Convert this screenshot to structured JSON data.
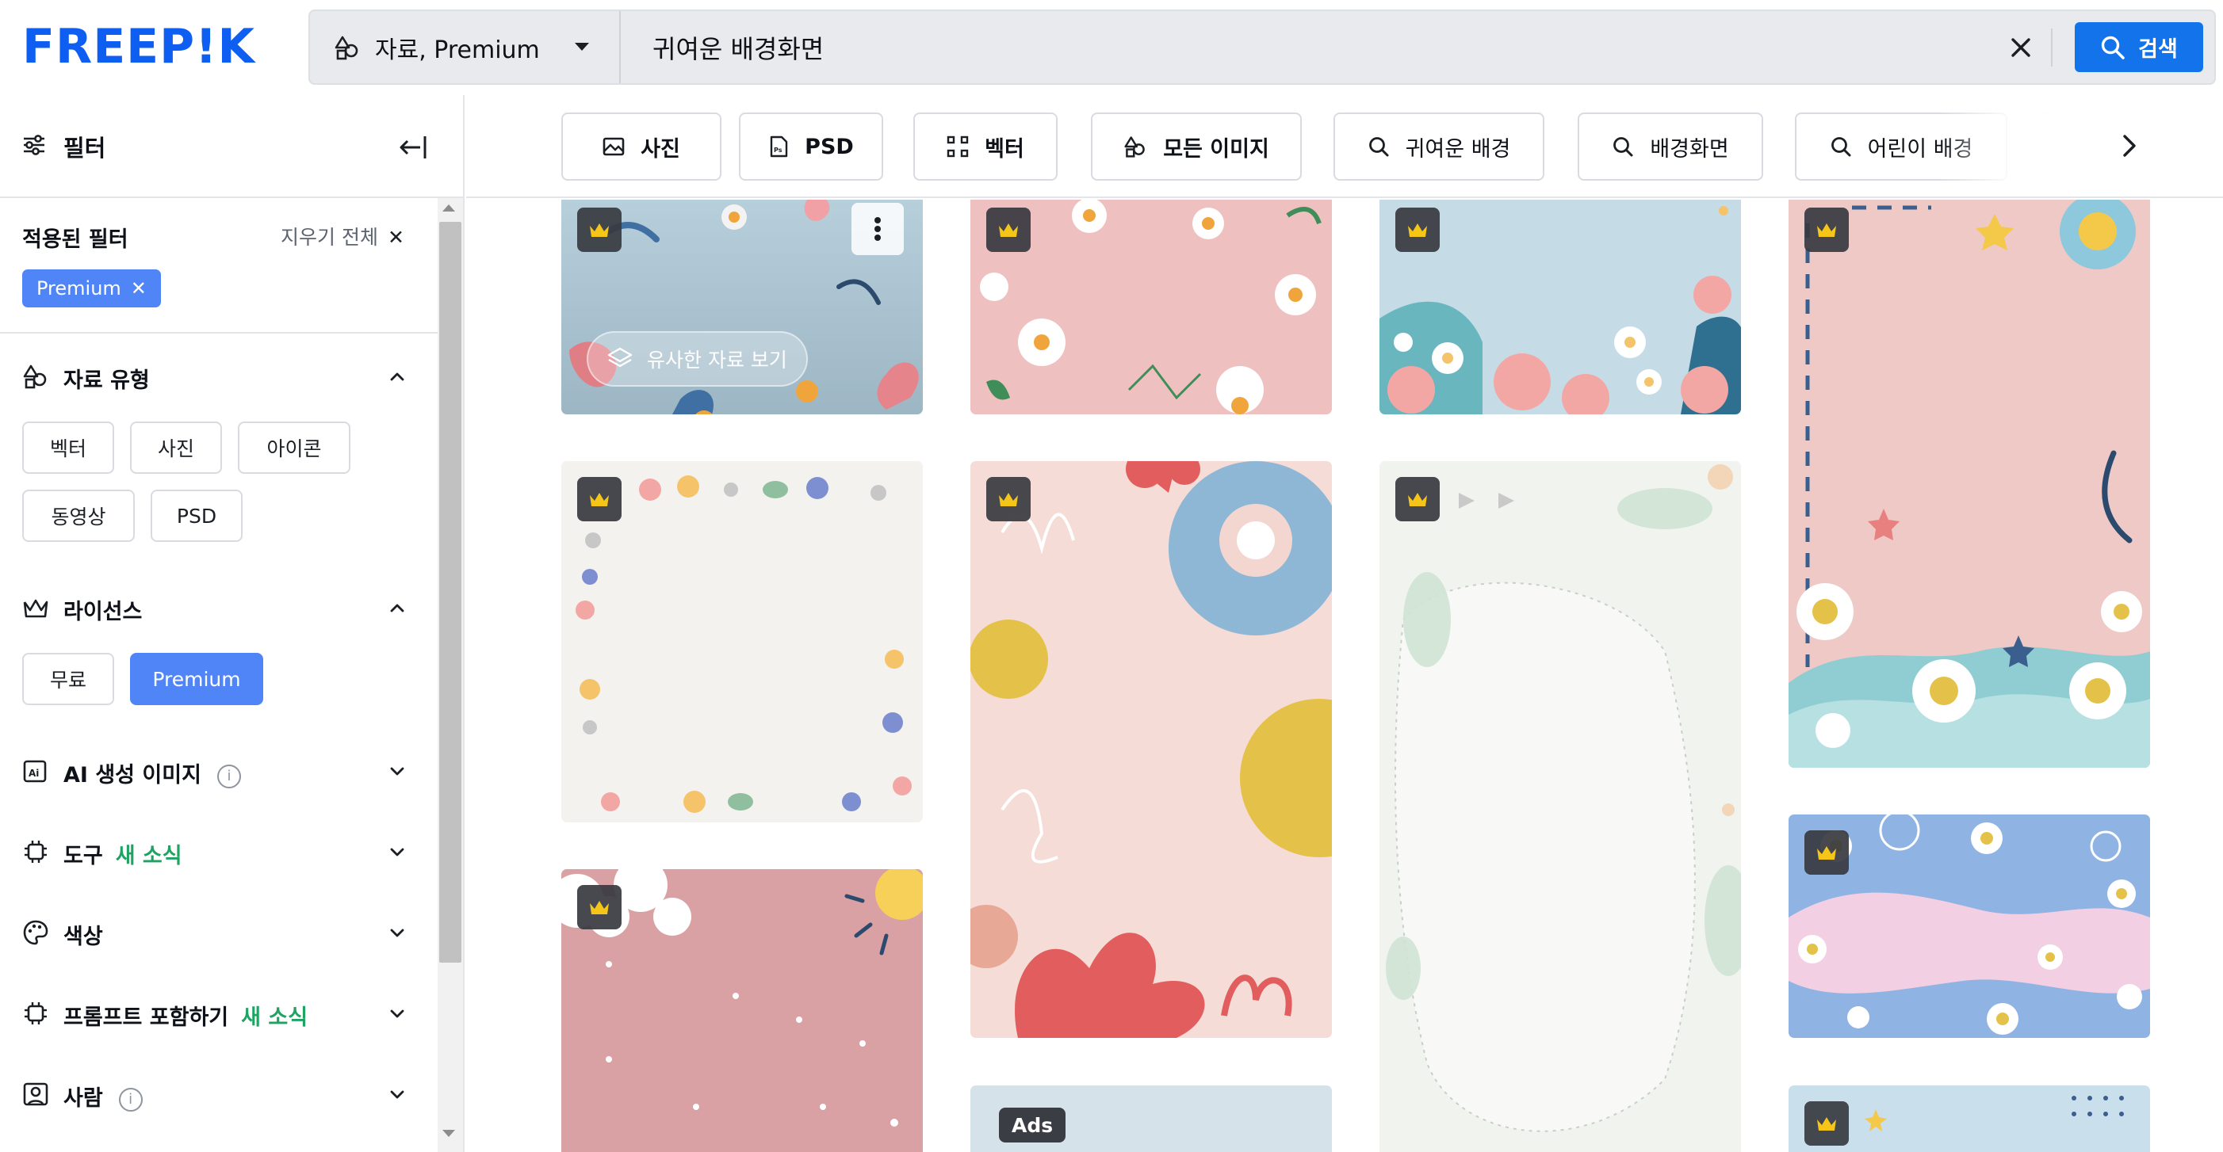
{
  "header": {
    "logo_text": "FREEP!K",
    "type_select_label": "자료, Premium",
    "search_value": "귀여운 배경화면",
    "search_button_label": "검색"
  },
  "sidebar": {
    "title": "필터",
    "applied": {
      "title": "적용된 필터",
      "clear_all": "지우기 전체",
      "chip": "Premium"
    },
    "sections": {
      "asset_type": {
        "title": "자료 유형",
        "options": [
          "벡터",
          "사진",
          "아이콘",
          "동영상",
          "PSD"
        ]
      },
      "license": {
        "title": "라이선스",
        "options": [
          "무료",
          "Premium"
        ],
        "selected": "Premium"
      },
      "ai": {
        "title": "AI 생성 이미지"
      },
      "tools": {
        "title": "도구",
        "badge": "새 소식"
      },
      "color": {
        "title": "색상"
      },
      "prompt": {
        "title": "프롬프트 포함하기",
        "badge": "새 소식"
      },
      "people": {
        "title": "사람"
      }
    }
  },
  "chips": [
    "사진",
    "PSD",
    "벡터",
    "모든 이미지",
    "귀여운 배경",
    "배경화면",
    "어린이 배경"
  ],
  "cards": {
    "similar_label": "유사한 자료 보기",
    "ads_label": "Ads"
  },
  "colors": {
    "accent": "#1273eb",
    "chip_active": "#4f85f7",
    "new_badge": "#1ea362",
    "logo": "#0e5ef2"
  }
}
